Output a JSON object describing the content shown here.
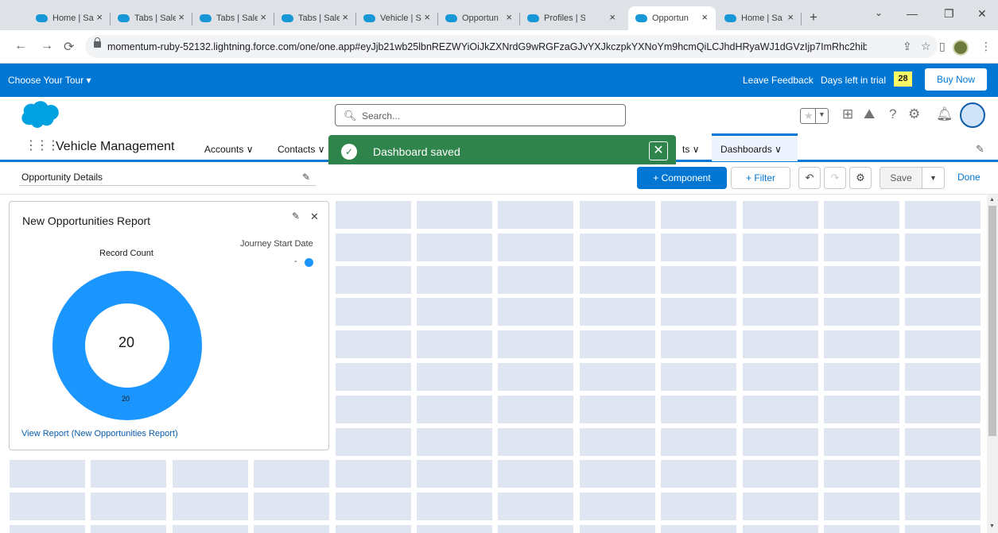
{
  "browser": {
    "tabs": [
      {
        "label": "Home | Sa"
      },
      {
        "label": "Tabs | Sale"
      },
      {
        "label": "Tabs | Sale"
      },
      {
        "label": "Tabs | Sale"
      },
      {
        "label": "Vehicle | S"
      },
      {
        "label": "Opportun"
      },
      {
        "label": "Profiles | S"
      },
      {
        "label": "Opportun"
      },
      {
        "label": "Home | Sa"
      }
    ],
    "url": "momentum-ruby-52132.lightning.force.com/one/one.app#eyJjb21wb25lbnREZWYiOiJkZXNrdG9wRGFzaGJvYXJkczpkYXNoYm9hcmQiLCJhdHRyaWJ1dGVzIjp7ImRhc2hib..."
  },
  "tourbar": {
    "choose_tour": "Choose Your Tour ▾",
    "leave_feedback": "Leave Feedback",
    "days_left_label": "Days left in trial",
    "days_left_value": "28",
    "buy_now": "Buy Now"
  },
  "header": {
    "search_placeholder": "Search..."
  },
  "appnav": {
    "app_name": "Vehicle Management",
    "items": [
      {
        "label": "Accounts"
      },
      {
        "label": "Contacts"
      },
      {
        "label": "ts"
      },
      {
        "label": "Dashboards"
      }
    ]
  },
  "toast": {
    "message": "Dashboard saved"
  },
  "dashboard": {
    "name": "Opportunity Details",
    "component_button": "Component",
    "filter_button": "Filter",
    "save_button": "Save",
    "done_button": "Done"
  },
  "widget": {
    "title": "New Opportunities Report",
    "legend_title": "Journey Start Date",
    "legend_entry": "-",
    "metric_label": "Record Count",
    "center_value": "20",
    "segment_label": "20",
    "view_report_link": "View Report (New Opportunities Report)",
    "chart_data": {
      "type": "pie",
      "categories": [
        "-"
      ],
      "values": [
        20
      ],
      "title": "Record Count",
      "legend_title": "Journey Start Date",
      "total": 20
    },
    "colors": {
      "segment": "#1b96ff"
    }
  },
  "colors": {
    "brand_blue": "#0176d3",
    "toast_green": "#2e844a",
    "grid_cell": "#dfe6f1"
  }
}
